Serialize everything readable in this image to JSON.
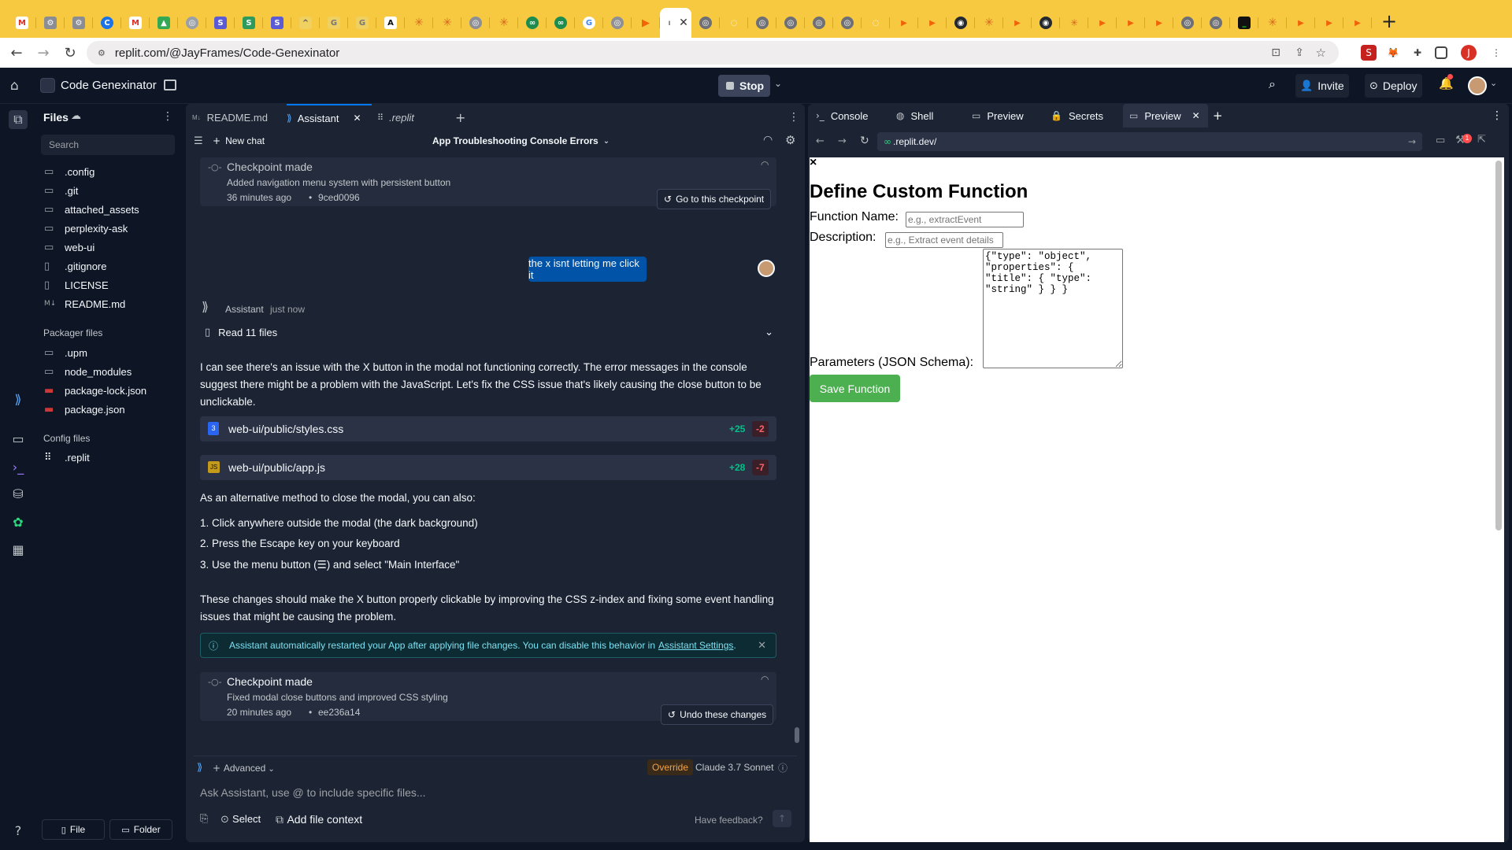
{
  "browser": {
    "url": "replit.com/@JayFrames/Code-Genexinator",
    "new_tab": "+"
  },
  "header": {
    "project_name": "Code Genexinator",
    "stop_label": "Stop",
    "invite_label": "Invite",
    "deploy_label": "Deploy"
  },
  "files_panel": {
    "title": "Files",
    "search_placeholder": "Search",
    "items": [
      ".config",
      ".git",
      "attached_assets",
      "perplexity-ask",
      "web-ui",
      ".gitignore",
      "LICENSE",
      "README.md"
    ],
    "packager_title": "Packager files",
    "packager_items": [
      ".upm",
      "node_modules",
      "package-lock.json",
      "package.json"
    ],
    "config_title": "Config files",
    "config_items": [
      ".replit"
    ],
    "new_file_label": "File",
    "new_folder_label": "Folder"
  },
  "center": {
    "tabs": [
      "README.md",
      "Assistant",
      ".replit"
    ],
    "new_chat_label": "New chat",
    "chat_title": "App Troubleshooting Console Errors",
    "checkpoint1": {
      "title": "Checkpoint made",
      "desc": "Added navigation menu system with persistent button",
      "time": "36 minutes ago",
      "hash": "9ced0096",
      "button": "Go to this checkpoint"
    },
    "user_message": "the x isnt letting me click it",
    "assistant_name": "Assistant",
    "assistant_time": "just now",
    "read_files": "Read 11 files",
    "para1": "I can see there's an issue with the X button in the modal not functioning correctly. The error messages in the console suggest there might be a problem with the JavaScript. Let's fix the CSS issue that's likely causing the close button to be unclickable.",
    "file1": {
      "name": "web-ui/public/styles.css",
      "add": "+25",
      "del": "-2"
    },
    "file2": {
      "name": "web-ui/public/app.js",
      "add": "+28",
      "del": "-7"
    },
    "para2": "As an alternative method to close the modal, you can also:",
    "list": [
      "1. Click anywhere outside the modal (the dark background)",
      "2. Press the Escape key on your keyboard",
      "3. Use the menu button (☰) and select \"Main Interface\""
    ],
    "para3": "These changes should make the X button properly clickable by improving the CSS z-index and fixing some event handling issues that might be causing the problem.",
    "notice_text": "Assistant automatically restarted your App after applying file changes. You can disable this behavior in",
    "notice_link": "Assistant Settings",
    "checkpoint2": {
      "title": "Checkpoint made",
      "desc": "Fixed modal close buttons and improved CSS styling",
      "time": "20 minutes ago",
      "hash": "ee236a14",
      "button": "Undo these changes"
    },
    "advanced_label": "Advanced",
    "override_label": "Override",
    "model_label": "Claude 3.7 Sonnet",
    "input_placeholder": "Ask Assistant, use @ to include specific files...",
    "select_label": "Select",
    "add_context_label": "Add file context",
    "feedback_label": "Have feedback?"
  },
  "right": {
    "tabs": [
      "Console",
      "Shell",
      "Preview",
      "Secrets",
      "Preview"
    ],
    "url": ".replit.dev/",
    "notif_count": "1"
  },
  "preview": {
    "close": "×",
    "heading": "Define Custom Function",
    "name_label": "Function Name:",
    "name_placeholder": "e.g., extractEvent",
    "desc_label": "Description:",
    "desc_placeholder": "e.g., Extract event details",
    "params_label": "Parameters (JSON Schema):",
    "params_value": "{\"type\": \"object\", \"properties\": { \"title\": { \"type\": \"string\" } } }",
    "save_label": "Save Function"
  },
  "colors": {
    "tabstrip": "#f6c941",
    "replit_bg": "#0e1525",
    "panel_bg": "#1c2333",
    "user_bubble": "#0053a6",
    "save_green": "#4caf50",
    "add_green": "#00c28a",
    "del_red": "#ff6166",
    "notice_bg": "#0d2b33"
  }
}
